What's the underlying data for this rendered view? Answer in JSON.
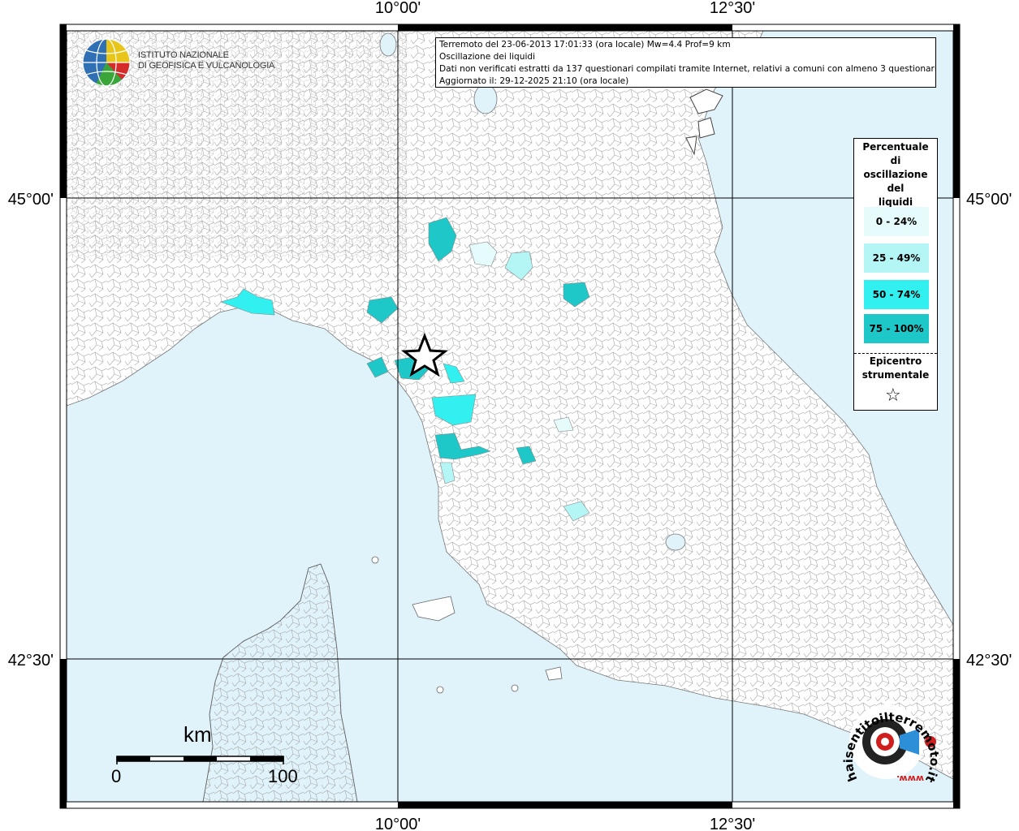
{
  "map_title": {
    "line1": "Terremoto del 23-06-2013 17:01:33 (ora locale) Mw=4.4 Prof=9 km",
    "line2": "Oscillazione dei liquidi",
    "line3": "Dati non verificati estratti da 137 questionari compilati tramite Internet, relativi a comuni con almeno 3 questionari.",
    "line4": "Aggiornato il: 29-12-2025 21:10 (ora locale)"
  },
  "axes": {
    "lon_labels": [
      "10°00'",
      "12°30'"
    ],
    "lat_labels": [
      "45°00'",
      "42°30'"
    ]
  },
  "institute": {
    "line1": "ISTITUTO NAZIONALE",
    "line2": "DI GEOFISICA E VULCANOLOGIA"
  },
  "legend": {
    "title_lines": [
      "Percentuale",
      "di",
      "oscillazione",
      "del",
      "liquidi"
    ],
    "classes": [
      {
        "label": "0 - 24%",
        "color": "#e6fbfb"
      },
      {
        "label": "25 - 49%",
        "color": "#b4f5f5"
      },
      {
        "label": "50 - 74%",
        "color": "#33f0f0"
      },
      {
        "label": "75 - 100%",
        "color": "#1ec8c8"
      }
    ],
    "epicenter_lines": [
      "Epicentro",
      "strumentale"
    ],
    "epicenter_symbol": "☆"
  },
  "scale": {
    "unit": "km",
    "start": "0",
    "end": "100"
  },
  "brand": {
    "text": "haisentitoilterremoto.it",
    "url_text": "www."
  },
  "colors": {
    "sea": "#e0f3fb",
    "land": "#ffffff",
    "border": "#999999"
  }
}
